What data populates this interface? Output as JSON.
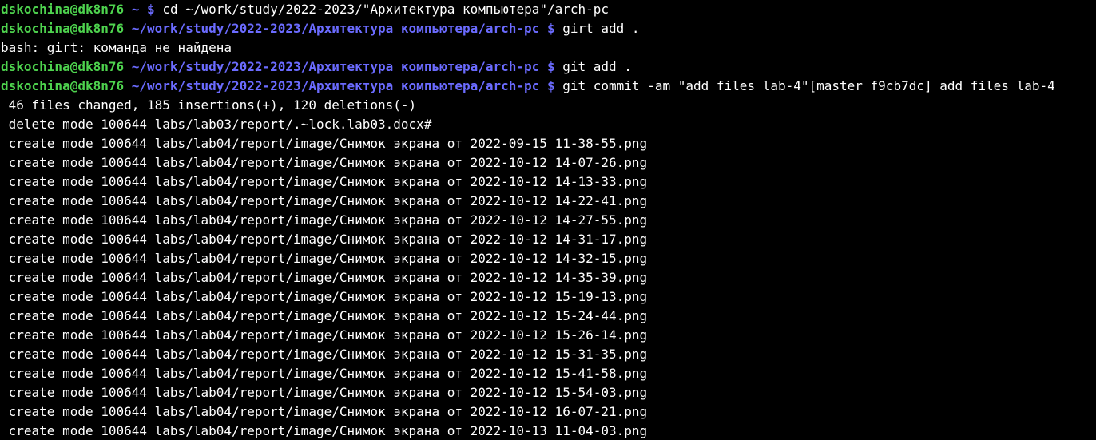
{
  "colors": {
    "background": "#000000",
    "user_host": "#4ed34e",
    "path": "#6b6bff",
    "text": "#ffffff"
  },
  "terminal": {
    "prompts": [
      {
        "user": "dskochina@dk8n76",
        "path": "~",
        "symbol": "$",
        "command": "cd ~/work/study/2022-2023/\"Архитектура компьютера\"/arch-pc"
      },
      {
        "user": "dskochina@dk8n76",
        "path": "~/work/study/2022-2023/Архитектура компьютера/arch-pc",
        "symbol": "$",
        "command": "girt add ."
      }
    ],
    "error_line": "bash: girt: команда не найдена",
    "prompts2": [
      {
        "user": "dskochina@dk8n76",
        "path": "~/work/study/2022-2023/Архитектура компьютера/arch-pc",
        "symbol": "$",
        "command": "git add ."
      },
      {
        "user": "dskochina@dk8n76",
        "path": "~/work/study/2022-2023/Архитектура компьютера/arch-pc",
        "symbol": "$",
        "command": "git commit -am \"add files lab-4\"[master f9cb7dc] add files lab-4"
      }
    ],
    "output": [
      " 46 files changed, 185 insertions(+), 120 deletions(-)",
      " delete mode 100644 labs/lab03/report/.~lock.lab03.docx#",
      " create mode 100644 labs/lab04/report/image/Снимок экрана от 2022-09-15 11-38-55.png",
      " create mode 100644 labs/lab04/report/image/Снимок экрана от 2022-10-12 14-07-26.png",
      " create mode 100644 labs/lab04/report/image/Снимок экрана от 2022-10-12 14-13-33.png",
      " create mode 100644 labs/lab04/report/image/Снимок экрана от 2022-10-12 14-22-41.png",
      " create mode 100644 labs/lab04/report/image/Снимок экрана от 2022-10-12 14-27-55.png",
      " create mode 100644 labs/lab04/report/image/Снимок экрана от 2022-10-12 14-31-17.png",
      " create mode 100644 labs/lab04/report/image/Снимок экрана от 2022-10-12 14-32-15.png",
      " create mode 100644 labs/lab04/report/image/Снимок экрана от 2022-10-12 14-35-39.png",
      " create mode 100644 labs/lab04/report/image/Снимок экрана от 2022-10-12 15-19-13.png",
      " create mode 100644 labs/lab04/report/image/Снимок экрана от 2022-10-12 15-24-44.png",
      " create mode 100644 labs/lab04/report/image/Снимок экрана от 2022-10-12 15-26-14.png",
      " create mode 100644 labs/lab04/report/image/Снимок экрана от 2022-10-12 15-31-35.png",
      " create mode 100644 labs/lab04/report/image/Снимок экрана от 2022-10-12 15-41-58.png",
      " create mode 100644 labs/lab04/report/image/Снимок экрана от 2022-10-12 15-54-03.png",
      " create mode 100644 labs/lab04/report/image/Снимок экрана от 2022-10-12 16-07-21.png",
      " create mode 100644 labs/lab04/report/image/Снимок экрана от 2022-10-13 11-04-03.png"
    ]
  }
}
